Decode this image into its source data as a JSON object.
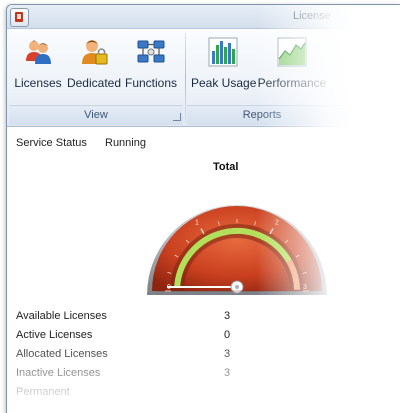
{
  "window": {
    "title": "License"
  },
  "ribbon": {
    "view_group": {
      "label": "View",
      "buttons": [
        {
          "label": "Licenses",
          "icon": "users-icon"
        },
        {
          "label": "Dedicated",
          "icon": "locked-user-icon"
        },
        {
          "label": "Functions",
          "icon": "functions-icon"
        }
      ]
    },
    "reports_group": {
      "label": "Reports",
      "buttons": [
        {
          "label": "Peak Usage",
          "icon": "bar-chart-icon"
        },
        {
          "label": "Performance",
          "icon": "performance-chart-icon"
        }
      ]
    }
  },
  "service": {
    "label": "Service Status",
    "value": "Running"
  },
  "gauge": {
    "title": "Total",
    "ticks": [
      "0",
      "1",
      "2",
      "3"
    ],
    "max": 3,
    "value": 0,
    "active_band_end": 2.5,
    "colors": {
      "body": "#c9401f",
      "band": "#b3e05a",
      "band_end": "#f0a070",
      "rim": "#8b8f96"
    }
  },
  "stats": [
    {
      "label": "Available Licenses",
      "value": "3"
    },
    {
      "label": "Active Licenses",
      "value": "0"
    },
    {
      "label": "Allocated Licenses",
      "value": "3"
    },
    {
      "label": "Inactive Licenses",
      "value": "3"
    },
    {
      "label": "Permanent",
      "value": ""
    }
  ]
}
